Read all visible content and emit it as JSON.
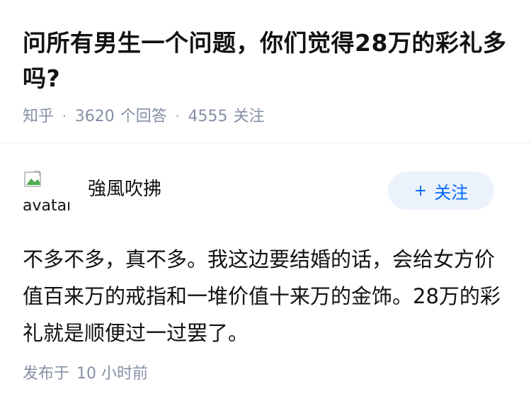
{
  "question": {
    "title": "问所有男生一个问题，你们觉得28万的彩礼多吗?",
    "source": "知乎",
    "answer_count": "3620",
    "answer_unit": "个回答",
    "follower_count": "4555",
    "follower_unit": "关注"
  },
  "answer": {
    "avatar_alt": "avatar",
    "avatar_icon": "broken-image-icon",
    "author_name": "強風吹拂",
    "follow_label": "关注",
    "follow_icon": "+",
    "content": "不多不多，真不多。我这边要结婚的话，会给女方价值百来万的戒指和一堆价值十来万的金饰。28万的彩礼就是顺便过一过罢了。",
    "published_prefix": "发布于",
    "published_time": "10 小时前"
  },
  "colors": {
    "text_primary": "#121212",
    "text_meta": "#8590a6",
    "accent_blue": "#0066ff",
    "follow_bg": "#ebf2fc",
    "divider": "#ebebeb"
  }
}
